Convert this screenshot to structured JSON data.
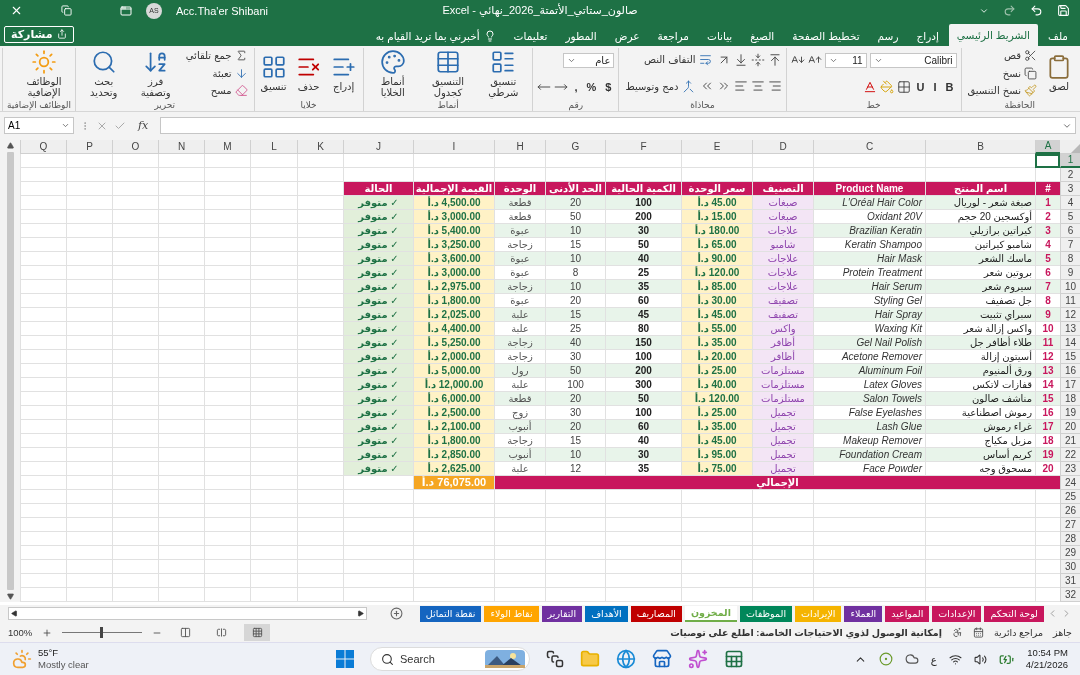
{
  "title_bar": {
    "title": "صالون_ستاتي_الأتمتة_2026_نهائي - Excel",
    "user": "Acc.Tha'er Shibani",
    "avatar": "AS"
  },
  "ribbon_tabs": [
    {
      "label": "ملف",
      "selected": false
    },
    {
      "label": "الشريط الرئيسي",
      "selected": true
    },
    {
      "label": "إدراج",
      "selected": false
    },
    {
      "label": "رسم",
      "selected": false
    },
    {
      "label": "تخطيط الصفحة",
      "selected": false
    },
    {
      "label": "الصيغ",
      "selected": false
    },
    {
      "label": "بيانات",
      "selected": false
    },
    {
      "label": "مراجعة",
      "selected": false
    },
    {
      "label": "عرض",
      "selected": false
    },
    {
      "label": "المطور",
      "selected": false
    },
    {
      "label": "تعليمات",
      "selected": false
    }
  ],
  "tell_me": "أخبرني بما تريد القيام به",
  "share": "مشاركة",
  "ribbon": {
    "groups": [
      {
        "label": "الحافظة",
        "columns": [
          [
            [
              {
                "kind": "large",
                "label": "لصق"
              }
            ]
          ],
          [
            [
              {
                "kind": "small",
                "label": "قص"
              }
            ],
            [
              {
                "kind": "small",
                "label": "نسخ"
              }
            ],
            [
              {
                "kind": "small",
                "label": "نسخ التنسيق"
              }
            ]
          ]
        ]
      },
      {
        "label": "خط",
        "columns": [
          [
            [
              {
                "kind": "field",
                "value": "Calibri"
              },
              {
                "kind": "field",
                "value": "11"
              },
              {
                "kind": "icon"
              },
              {
                "kind": "icon"
              }
            ],
            [
              {
                "kind": "glyph",
                "label": "B"
              },
              {
                "kind": "glyph",
                "label": "I"
              },
              {
                "kind": "glyph",
                "label": "U"
              },
              {
                "kind": "icon"
              },
              {
                "kind": "icon"
              },
              {
                "kind": "icon"
              }
            ]
          ]
        ]
      },
      {
        "label": "محاذاة",
        "columns": [
          [
            [
              {
                "kind": "icon"
              },
              {
                "kind": "icon"
              },
              {
                "kind": "icon"
              },
              {
                "kind": "icon"
              },
              {
                "kind": "small",
                "label": "التفاف النص"
              }
            ],
            [
              {
                "kind": "icon"
              },
              {
                "kind": "icon"
              },
              {
                "kind": "icon"
              },
              {
                "kind": "icon"
              },
              {
                "kind": "icon"
              },
              {
                "kind": "small",
                "label": "دمج وتوسيط"
              }
            ]
          ]
        ]
      },
      {
        "label": "رقم",
        "columns": [
          [
            [
              {
                "kind": "field",
                "value": "عام"
              }
            ],
            [
              {
                "kind": "glyph",
                "label": "$"
              },
              {
                "kind": "glyph",
                "label": "%"
              },
              {
                "kind": "glyph",
                "label": ","
              },
              {
                "kind": "icon"
              },
              {
                "kind": "icon"
              }
            ]
          ]
        ]
      },
      {
        "label": "أنماط",
        "columns": [
          [
            [
              {
                "kind": "large",
                "label": "تنسيق شرطي"
              }
            ]
          ],
          [
            [
              {
                "kind": "large",
                "label": "التنسيق كجدول"
              }
            ]
          ],
          [
            [
              {
                "kind": "large",
                "label": "أنماط الخلايا"
              }
            ]
          ]
        ]
      },
      {
        "label": "خلايا",
        "columns": [
          [
            [
              {
                "kind": "large",
                "label": "إدراج"
              }
            ]
          ],
          [
            [
              {
                "kind": "large",
                "label": "حذف"
              }
            ]
          ],
          [
            [
              {
                "kind": "large",
                "label": "تنسيق"
              }
            ]
          ]
        ]
      },
      {
        "label": "تحرير",
        "columns": [
          [
            [
              {
                "kind": "small",
                "label": "جمع تلقائي"
              }
            ],
            [
              {
                "kind": "small",
                "label": "تعبئة"
              }
            ],
            [
              {
                "kind": "small",
                "label": "مسح"
              }
            ]
          ],
          [
            [
              {
                "kind": "large",
                "label": "فرز وتصفية"
              }
            ]
          ],
          [
            [
              {
                "kind": "large",
                "label": "بحث وتحديد"
              }
            ]
          ]
        ]
      },
      {
        "label": "الوظائف الإضافية",
        "columns": [
          [
            [
              {
                "kind": "large",
                "label": "الوظائف الإضافية"
              }
            ]
          ]
        ]
      }
    ]
  },
  "formula_bar": {
    "name_box": "A1",
    "function_label": "fx"
  },
  "sheet": {
    "columns": [
      {
        "label": "A",
        "selected": true
      },
      {
        "label": "B",
        "selected": false
      },
      {
        "label": "C",
        "selected": false
      },
      {
        "label": "D",
        "selected": false
      },
      {
        "label": "E",
        "selected": false
      },
      {
        "label": "F",
        "selected": false
      },
      {
        "label": "G",
        "selected": false
      },
      {
        "label": "H",
        "selected": false
      },
      {
        "label": "I",
        "selected": false
      },
      {
        "label": "J",
        "selected": false
      },
      {
        "label": "K",
        "selected": false
      },
      {
        "label": "L",
        "selected": false
      },
      {
        "label": "M",
        "selected": false
      },
      {
        "label": "N",
        "selected": false
      },
      {
        "label": "O",
        "selected": false
      },
      {
        "label": "P",
        "selected": false
      },
      {
        "label": "Q",
        "selected": false
      }
    ],
    "rows": [
      {
        "label": "1",
        "selected": true
      },
      {
        "label": "2",
        "selected": false
      },
      {
        "label": "3",
        "selected": false
      },
      {
        "label": "4",
        "selected": false
      },
      {
        "label": "5",
        "selected": false
      },
      {
        "label": "6",
        "selected": false
      },
      {
        "label": "7",
        "selected": false
      },
      {
        "label": "8",
        "selected": false
      },
      {
        "label": "9",
        "selected": false
      },
      {
        "label": "10",
        "selected": false
      },
      {
        "label": "11",
        "selected": false
      },
      {
        "label": "12",
        "selected": false
      },
      {
        "label": "13",
        "selected": false
      },
      {
        "label": "14",
        "selected": false
      },
      {
        "label": "15",
        "selected": false
      },
      {
        "label": "16",
        "selected": false
      },
      {
        "label": "17",
        "selected": false
      },
      {
        "label": "18",
        "selected": false
      },
      {
        "label": "19",
        "selected": false
      },
      {
        "label": "20",
        "selected": false
      },
      {
        "label": "21",
        "selected": false
      },
      {
        "label": "22",
        "selected": false
      },
      {
        "label": "23",
        "selected": false
      },
      {
        "label": "24",
        "selected": false
      },
      {
        "label": "25",
        "selected": false
      },
      {
        "label": "26",
        "selected": false
      },
      {
        "label": "27",
        "selected": false
      },
      {
        "label": "28",
        "selected": false
      },
      {
        "label": "29",
        "selected": false
      },
      {
        "label": "30",
        "selected": false
      },
      {
        "label": "31",
        "selected": false
      },
      {
        "label": "32",
        "selected": false
      }
    ],
    "table": {
      "header": [
        "#",
        "اسم المنتج",
        "Product Name",
        "التصنيف",
        "سعر الوحدة",
        "الكمية الحالية",
        "الحد الأدنى",
        "الوحدة",
        "القيمة الإجمالية",
        "الحالة"
      ],
      "rows": [
        [
          "1",
          "صبغة شعر - لوريال",
          "L'Oréal Hair Color",
          "صبغات",
          "45.00 د.أ",
          "100",
          "20",
          "قطعة",
          "4,500.00 د.أ",
          "✓ متوفر"
        ],
        [
          "2",
          "أوكسجين 20 حجم",
          "Oxidant 20V",
          "صبغات",
          "15.00 د.أ",
          "200",
          "50",
          "قطعة",
          "3,000.00 د.أ",
          "✓ متوفر"
        ],
        [
          "3",
          "كيراتين برازيلي",
          "Brazilian Keratin",
          "علاجات",
          "180.00 د.أ",
          "30",
          "10",
          "عبوة",
          "5,400.00 د.أ",
          "✓ متوفر"
        ],
        [
          "4",
          "شامبو كيراتين",
          "Keratin Shampoo",
          "شامبو",
          "65.00 د.أ",
          "50",
          "15",
          "زجاجة",
          "3,250.00 د.أ",
          "✓ متوفر"
        ],
        [
          "5",
          "ماسك الشعر",
          "Hair Mask",
          "علاجات",
          "90.00 د.أ",
          "40",
          "10",
          "عبوة",
          "3,600.00 د.أ",
          "✓ متوفر"
        ],
        [
          "6",
          "بروتين شعر",
          "Protein Treatment",
          "علاجات",
          "120.00 د.أ",
          "25",
          "8",
          "عبوة",
          "3,000.00 د.أ",
          "✓ متوفر"
        ],
        [
          "7",
          "سيروم شعر",
          "Hair Serum",
          "علاجات",
          "85.00 د.أ",
          "35",
          "10",
          "زجاجة",
          "2,975.00 د.أ",
          "✓ متوفر"
        ],
        [
          "8",
          "جل تصفيف",
          "Styling Gel",
          "تصفيف",
          "30.00 د.أ",
          "60",
          "20",
          "عبوة",
          "1,800.00 د.أ",
          "✓ متوفر"
        ],
        [
          "9",
          "سبراي تثبيت",
          "Hair Spray",
          "تصفيف",
          "45.00 د.أ",
          "45",
          "15",
          "علبة",
          "2,025.00 د.أ",
          "✓ متوفر"
        ],
        [
          "10",
          "واكس إزالة شعر",
          "Waxing Kit",
          "واكس",
          "55.00 د.أ",
          "80",
          "25",
          "علبة",
          "4,400.00 د.أ",
          "✓ متوفر"
        ],
        [
          "11",
          "طلاء أظافر جل",
          "Gel Nail Polish",
          "أظافر",
          "35.00 د.أ",
          "150",
          "40",
          "زجاجة",
          "5,250.00 د.أ",
          "✓ متوفر"
        ],
        [
          "12",
          "أسيتون إزالة",
          "Acetone Remover",
          "أظافر",
          "20.00 د.أ",
          "100",
          "30",
          "زجاجة",
          "2,000.00 د.أ",
          "✓ متوفر"
        ],
        [
          "13",
          "ورق ألمنيوم",
          "Aluminum Foil",
          "مستلزمات",
          "25.00 د.أ",
          "200",
          "50",
          "رول",
          "5,000.00 د.أ",
          "✓ متوفر"
        ],
        [
          "14",
          "قفازات لاتكس",
          "Latex Gloves",
          "مستلزمات",
          "40.00 د.أ",
          "300",
          "100",
          "علبة",
          "12,000.00 د.أ",
          "✓ متوفر"
        ],
        [
          "15",
          "مناشف صالون",
          "Salon Towels",
          "مستلزمات",
          "120.00 د.أ",
          "50",
          "20",
          "قطعة",
          "6,000.00 د.أ",
          "✓ متوفر"
        ],
        [
          "16",
          "رموش اصطناعية",
          "False Eyelashes",
          "تجميل",
          "25.00 د.أ",
          "100",
          "30",
          "زوج",
          "2,500.00 د.أ",
          "✓ متوفر"
        ],
        [
          "17",
          "غراء رموش",
          "Lash Glue",
          "تجميل",
          "35.00 د.أ",
          "60",
          "20",
          "أنبوب",
          "2,100.00 د.أ",
          "✓ متوفر"
        ],
        [
          "18",
          "مزيل مكياج",
          "Makeup Remover",
          "تجميل",
          "45.00 د.أ",
          "40",
          "15",
          "زجاجة",
          "1,800.00 د.أ",
          "✓ متوفر"
        ],
        [
          "19",
          "كريم أساس",
          "Foundation Cream",
          "تجميل",
          "95.00 د.أ",
          "30",
          "10",
          "أنبوب",
          "2,850.00 د.أ",
          "✓ متوفر"
        ],
        [
          "20",
          "مسحوق وجه",
          "Face Powder",
          "تجميل",
          "75.00 د.أ",
          "35",
          "12",
          "علبة",
          "2,625.00 د.أ",
          "✓ متوفر"
        ]
      ],
      "total": {
        "label": "الإجمالي",
        "value": "76,075.00 د.أ"
      }
    }
  },
  "sheet_tabs": [
    {
      "label": "لوحة التحكم",
      "color": "#c8175d",
      "selected": false
    },
    {
      "label": "الإعدادات",
      "color": "#c8175d",
      "selected": false
    },
    {
      "label": "المواعيد",
      "color": "#c8175d",
      "selected": false
    },
    {
      "label": "العملاء",
      "color": "#7030a0",
      "selected": false
    },
    {
      "label": "الإيرادات",
      "color": "#f5b400",
      "selected": false
    },
    {
      "label": "الموظفات",
      "color": "#00875a",
      "selected": false
    },
    {
      "label": "المخزون",
      "color": "#70ad47",
      "selected": true
    },
    {
      "label": "المصاريف",
      "color": "#c00000",
      "selected": false
    },
    {
      "label": "الأهداف",
      "color": "#0070c0",
      "selected": false
    },
    {
      "label": "التقارير",
      "color": "#7030a0",
      "selected": false
    },
    {
      "label": "نقاط الولاء",
      "color": "#ffa500",
      "selected": false
    },
    {
      "label": "نقطة التماثل",
      "color": "#1565c0",
      "selected": false
    }
  ],
  "status_bar": {
    "mode": "جاهز",
    "circular": "مراجع دائرية",
    "accessibility": "إمكانية الوصول لذوي الاحتياجات الخاصة: اطلع على توصيات",
    "views": [
      {
        "selected": true
      },
      {
        "selected": false
      },
      {
        "selected": false
      }
    ],
    "zoom": {
      "level": 0.5,
      "label": "100%"
    }
  },
  "taskbar": {
    "temperature": "55°F",
    "weather": "Mostly clear",
    "search": "Search",
    "language": "ع",
    "time": "10:54 PM",
    "date": "4/21/2026"
  }
}
